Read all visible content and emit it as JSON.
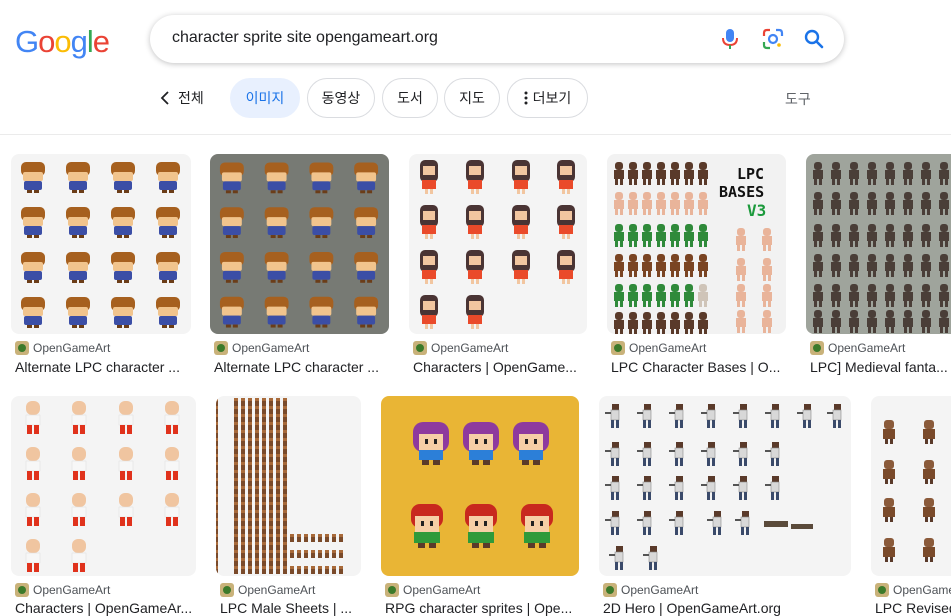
{
  "logo": {
    "text": "Google"
  },
  "search": {
    "query": "character sprite site opengameart.org"
  },
  "icons": {
    "mic": "mic-icon",
    "lens": "google-lens-icon",
    "search": "search-icon"
  },
  "tabs": {
    "back_label": "전체",
    "items": [
      {
        "label": "이미지",
        "active": true
      },
      {
        "label": "동영상",
        "active": false
      },
      {
        "label": "도서",
        "active": false
      },
      {
        "label": "지도",
        "active": false
      },
      {
        "label": "더보기",
        "active": false
      }
    ],
    "tools_label": "도구"
  },
  "results": [
    {
      "source": "OpenGameArt",
      "title": "Alternate LPC character ..."
    },
    {
      "source": "OpenGameArt",
      "title": "Alternate LPC character ..."
    },
    {
      "source": "OpenGameArt",
      "title": "Characters | OpenGame..."
    },
    {
      "source": "OpenGameArt",
      "title": "LPC Character Bases | O..."
    },
    {
      "source": "OpenGameArt",
      "title": "LPC] Medieval fanta..."
    },
    {
      "source": "OpenGameArt",
      "title": "Characters | OpenGameAr..."
    },
    {
      "source": "OpenGameArt",
      "title": "LPC Male Sheets | ..."
    },
    {
      "source": "OpenGameArt",
      "title": "RPG character sprites | Ope..."
    },
    {
      "source": "OpenGameArt",
      "title": "2D Hero | OpenGameArt.org"
    },
    {
      "source": "OpenGameArt",
      "title": "LPC Revised"
    }
  ],
  "image_text": {
    "lpc_line1": "LPC",
    "lpc_line2": "BASES",
    "lpc_line3": "V3"
  },
  "colors": {
    "accent": "#1a73e8",
    "chip_active_bg": "#e8f0fe",
    "row2_yellow_bg": "#e9b535",
    "gray_bg": "#777a74"
  }
}
